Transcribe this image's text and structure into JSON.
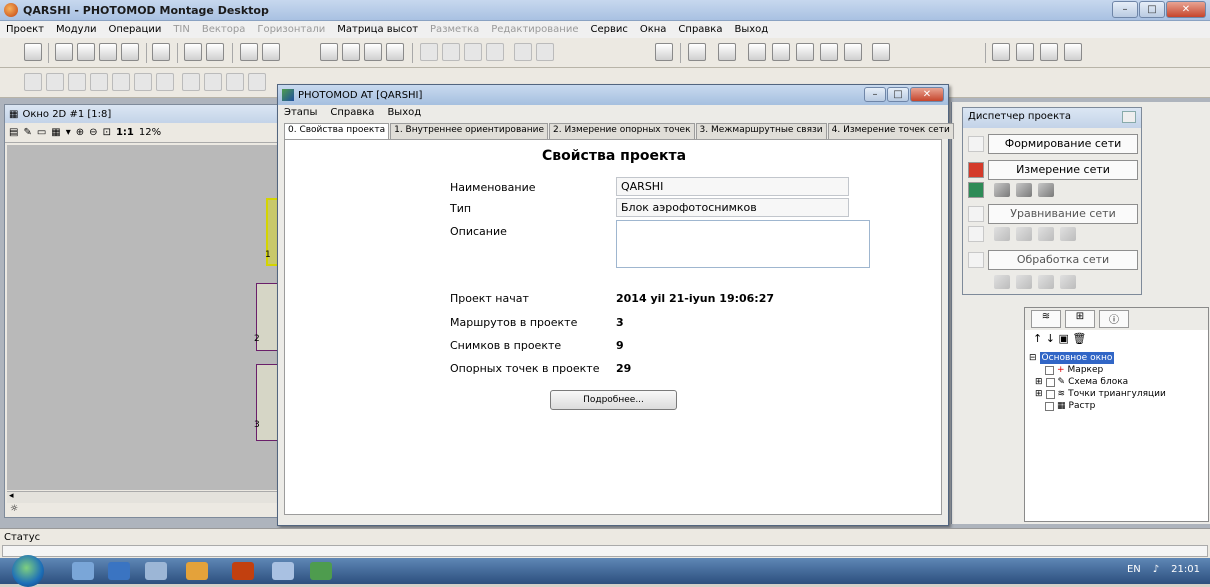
{
  "app": {
    "title": "QARSHI - PHOTOMOD Montage Desktop"
  },
  "menu": {
    "items": [
      {
        "label": "Проект",
        "enabled": true
      },
      {
        "label": "Модули",
        "enabled": true
      },
      {
        "label": "Операции",
        "enabled": true
      },
      {
        "label": "TIN",
        "enabled": false
      },
      {
        "label": "Вектора",
        "enabled": false
      },
      {
        "label": "Горизонтали",
        "enabled": false
      },
      {
        "label": "Матрица высот",
        "enabled": true
      },
      {
        "label": "Разметка",
        "enabled": false
      },
      {
        "label": "Редактирование",
        "enabled": false
      },
      {
        "label": "Сервис",
        "enabled": true
      },
      {
        "label": "Окна",
        "enabled": true
      },
      {
        "label": "Справка",
        "enabled": true
      },
      {
        "label": "Выход",
        "enabled": true
      }
    ]
  },
  "win2d": {
    "title": "Окно 2D #1 [1:8]",
    "zoom": "1:1",
    "zoom_pct": "12%",
    "strip_labels": [
      "1",
      "2",
      "3"
    ]
  },
  "dialog": {
    "title": "PHOTOMOD AT [QARSHI]",
    "menu": [
      "Этапы",
      "Справка",
      "Выход"
    ],
    "tabs": [
      "0. Свойства проекта",
      "1. Внутреннее ориентирование",
      "2. Измерение опорных точек",
      "3. Межмаршрутные связи",
      "4. Измерение точек сети"
    ],
    "heading": "Свойства проекта",
    "name_label": "Наименование",
    "name_value": "QARSHI",
    "type_label": "Тип",
    "type_value": "Блок аэрофотоснимков",
    "desc_label": "Описание",
    "started_label": "Проект начат",
    "started_value": "2014 yil 21-iyun 19:06:27",
    "routes_label": "Маршрутов в проекте",
    "routes_value": "3",
    "images_label": "Снимков в проекте",
    "images_value": "9",
    "gcp_label": "Опорных точек в проекте",
    "gcp_value": "29",
    "more_button": "Подробнее..."
  },
  "manager": {
    "title": "Диспетчер проекта",
    "sections": [
      "Формирование сети",
      "Измерение сети",
      "Уравнивание сети",
      "Обработка сети"
    ]
  },
  "layers": {
    "root": "Основное окно",
    "items": [
      "Маркер",
      "Схема блока",
      "Точки триангуляции",
      "Растр"
    ]
  },
  "status": {
    "label": "Статус"
  },
  "tray": {
    "lang": "EN",
    "time": "21:01"
  }
}
